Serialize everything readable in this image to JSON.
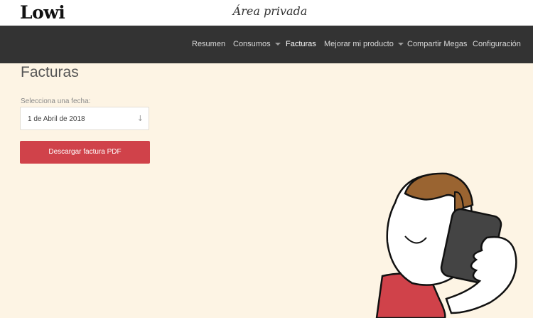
{
  "header": {
    "logo": "Lowi",
    "area_title": "Área privada"
  },
  "nav": {
    "items": [
      {
        "label": "Resumen",
        "has_dropdown": false,
        "active": false
      },
      {
        "label": "Consumos",
        "has_dropdown": true,
        "active": false
      },
      {
        "label": "Facturas",
        "has_dropdown": false,
        "active": true
      },
      {
        "label": "Mejorar mi producto",
        "has_dropdown": true,
        "active": false
      },
      {
        "label": "Compartir Megas",
        "has_dropdown": false,
        "active": false
      },
      {
        "label": "Configuración",
        "has_dropdown": false,
        "active": false
      }
    ]
  },
  "main": {
    "title": "Facturas",
    "date_label": "Selecciona una fecha:",
    "date_value": "1 de Abril de 2018",
    "select_icon": "arrow-down-icon",
    "download_label": "Descargar factura PDF"
  },
  "colors": {
    "background": "#fdf4e4",
    "navbar": "#333333",
    "accent": "#d0424a"
  }
}
